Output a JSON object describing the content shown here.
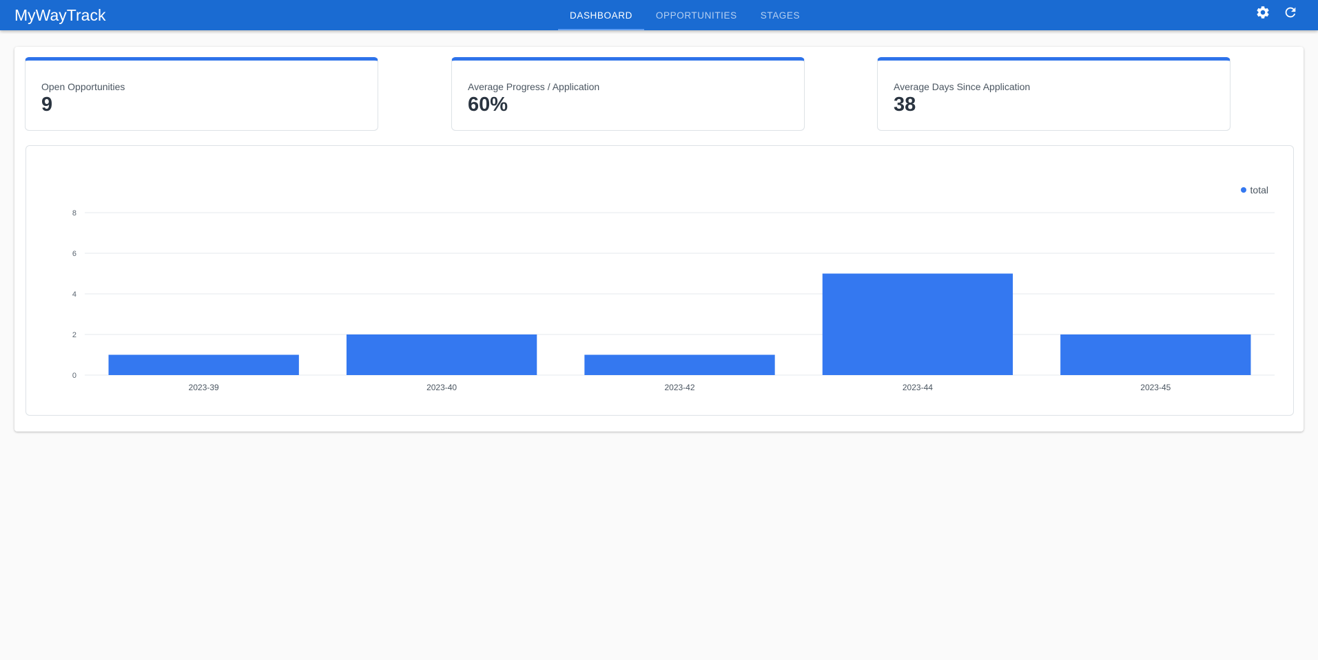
{
  "app": {
    "title": "MyWayTrack"
  },
  "nav": {
    "tabs": [
      {
        "label": "DASHBOARD",
        "active": true
      },
      {
        "label": "OPPORTUNITIES",
        "active": false
      },
      {
        "label": "STAGES",
        "active": false
      }
    ],
    "icons": [
      "gear-icon",
      "refresh-icon"
    ]
  },
  "stats": [
    {
      "label": "Open Opportunities",
      "value": "9"
    },
    {
      "label": "Average Progress / Application",
      "value": "60%"
    },
    {
      "label": "Average Days Since Application",
      "value": "38"
    }
  ],
  "colors": {
    "appbar": "#1a6bd2",
    "accent": "#2e73ea",
    "bar": "#3478f0"
  },
  "chart_data": {
    "type": "bar",
    "categories": [
      "2023-39",
      "2023-40",
      "2023-42",
      "2023-44",
      "2023-45"
    ],
    "series": [
      {
        "name": "total",
        "values": [
          1,
          2,
          1,
          5,
          2
        ]
      }
    ],
    "ylim": [
      0,
      8
    ],
    "yticks": [
      0,
      2,
      4,
      6,
      8
    ],
    "grid": true,
    "legend": "top-right"
  }
}
